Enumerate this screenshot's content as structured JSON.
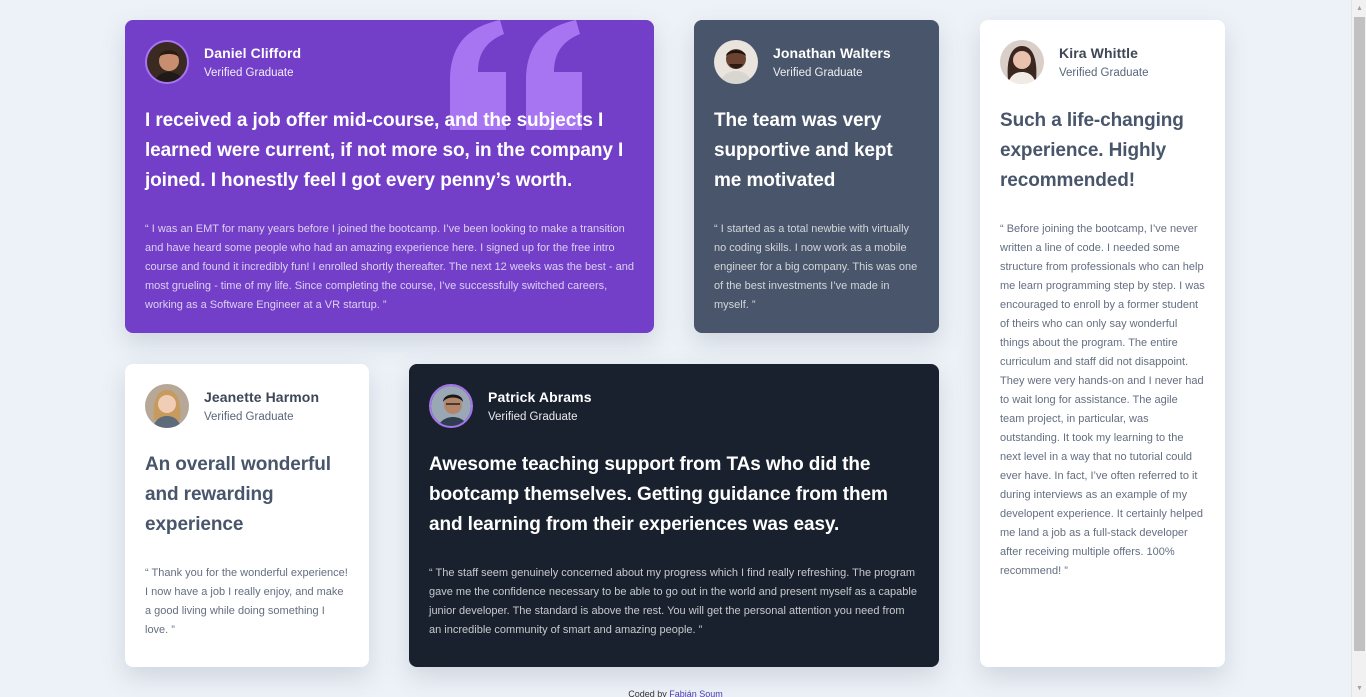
{
  "colors": {
    "page_bg": "#edf2f8",
    "purple": "#733fc8",
    "gray_blue": "#48556a",
    "dark": "#19212e",
    "white": "#ffffff",
    "accent": "#a775f1"
  },
  "testimonials": [
    {
      "name": "Daniel Clifford",
      "role": "Verified Graduate",
      "headline": "I received a job offer mid-course, and the subjects I learned were current, if not more so, in the company I joined. I honestly feel I got every penny’s worth.",
      "quote": "“ I was an EMT for many years before I joined the bootcamp. I’ve been looking to make a transition and have heard some people who had an amazing experience here. I signed up for the free intro course and found it incredibly fun! I enrolled shortly thereafter. The next 12 weeks was the best - and most grueling - time of my life. Since completing the course, I’ve successfully switched careers, working as a Software Engineer at a VR startup. ”",
      "avatar_icon": "avatar-daniel"
    },
    {
      "name": "Jonathan Walters",
      "role": "Verified Graduate",
      "headline": "The team was very supportive and kept me motivated",
      "quote": "“ I started as a total newbie with virtually no coding skills. I now work as a mobile engineer for a big company. This was one of the best investments I’ve made in myself. ”",
      "avatar_icon": "avatar-jonathan"
    },
    {
      "name": "Kira Whittle",
      "role": "Verified Graduate",
      "headline": "Such a life-changing experience. Highly recommended!",
      "quote": "“ Before joining the bootcamp, I’ve never written a line of code. I needed some structure from professionals who can help me learn programming step by step. I was encouraged to enroll by a former student of theirs who can only say wonderful things about the program. The entire curriculum and staff did not disappoint. They were very hands-on and I never had to wait long for assistance. The agile team project, in particular, was outstanding. It took my learning to the next level in a way that no tutorial could ever have. In fact, I’ve often referred to it during interviews as an example of my developent experience. It certainly helped me land a job as a full-stack developer after receiving multiple offers. 100% recommend! ”",
      "avatar_icon": "avatar-kira"
    },
    {
      "name": "Jeanette Harmon",
      "role": "Verified Graduate",
      "headline": "An overall wonderful and rewarding experience",
      "quote": "“ Thank you for the wonderful experience! I now have a job I really enjoy, and make a good living while doing something I love. ”",
      "avatar_icon": "avatar-jeanette"
    },
    {
      "name": "Patrick Abrams",
      "role": "Verified Graduate",
      "headline": "Awesome teaching support from TAs who did the bootcamp themselves. Getting guidance from them and learning from their experiences was easy.",
      "quote": "“ The staff seem genuinely concerned about my progress which I find really refreshing. The program gave me the confidence necessary to be able to go out in the world and present myself as a capable junior developer. The standard is above the rest. You will get the personal attention you need from an incredible community of smart and amazing people. ”",
      "avatar_icon": "avatar-patrick"
    }
  ],
  "footer": {
    "prefix": "Coded by",
    "author": "Fabián Soum"
  }
}
